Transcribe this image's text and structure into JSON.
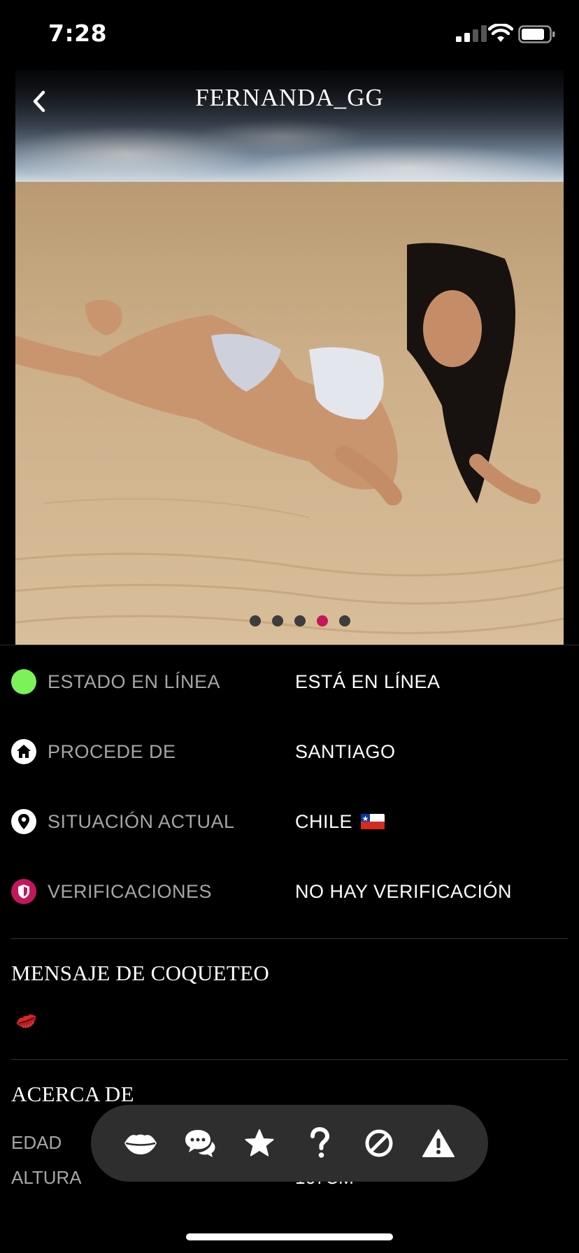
{
  "status_bar": {
    "time": "7:28"
  },
  "profile": {
    "name": "FERNANDA_GG",
    "photo_count": 5,
    "active_photo_index": 3
  },
  "info": [
    {
      "icon": "online-status-icon",
      "label": "ESTADO EN LÍNEA",
      "value": "ESTÁ EN LÍNEA",
      "color": "#7cf25a"
    },
    {
      "icon": "home-icon",
      "label": "PROCEDE DE",
      "value": "SANTIAGO"
    },
    {
      "icon": "location-pin-icon",
      "label": "SITUACIÓN ACTUAL",
      "value": "CHILE",
      "flag": "chile-flag"
    },
    {
      "icon": "shield-icon",
      "label": "VERIFICACIONES",
      "value": "NO HAY VERIFICACIÓN",
      "color": "#c2185b"
    }
  ],
  "flirt": {
    "title": "MENSAJE DE COQUETEO",
    "icon": "kiss-lips-icon"
  },
  "about": {
    "title": "ACERCA DE",
    "rows": [
      {
        "label": "EDAD",
        "value": ""
      },
      {
        "label": "ALTURA",
        "value": "167CM"
      }
    ]
  },
  "actions": [
    {
      "name": "kiss-button",
      "icon": "lips-icon"
    },
    {
      "name": "chat-button",
      "icon": "chat-bubbles-icon"
    },
    {
      "name": "favorite-button",
      "icon": "star-icon"
    },
    {
      "name": "question-button",
      "icon": "question-icon"
    },
    {
      "name": "block-button",
      "icon": "block-icon"
    },
    {
      "name": "report-button",
      "icon": "warning-icon"
    }
  ],
  "colors": {
    "accent": "#c2185b",
    "online": "#7cf25a",
    "background": "#000000",
    "action_bar": "#2e2e2e"
  }
}
